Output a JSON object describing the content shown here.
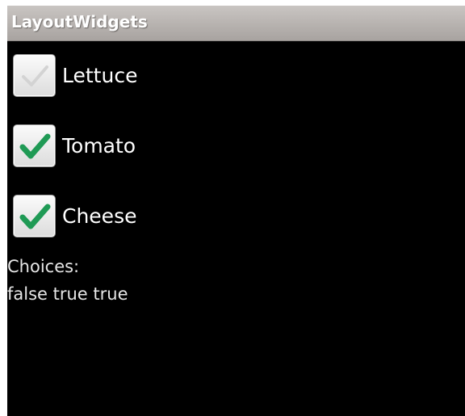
{
  "app": {
    "title": "LayoutWidgets"
  },
  "checkboxes": [
    {
      "label": "Lettuce",
      "checked": false
    },
    {
      "label": "Tomato",
      "checked": true
    },
    {
      "label": "Cheese",
      "checked": true
    }
  ],
  "choices": {
    "heading": "Choices:",
    "value": "false true true"
  },
  "colors": {
    "check": "#1f9a55",
    "check_unchecked": "#d3d3d3",
    "background": "#000000",
    "titlebar": "#b9b5b2"
  }
}
